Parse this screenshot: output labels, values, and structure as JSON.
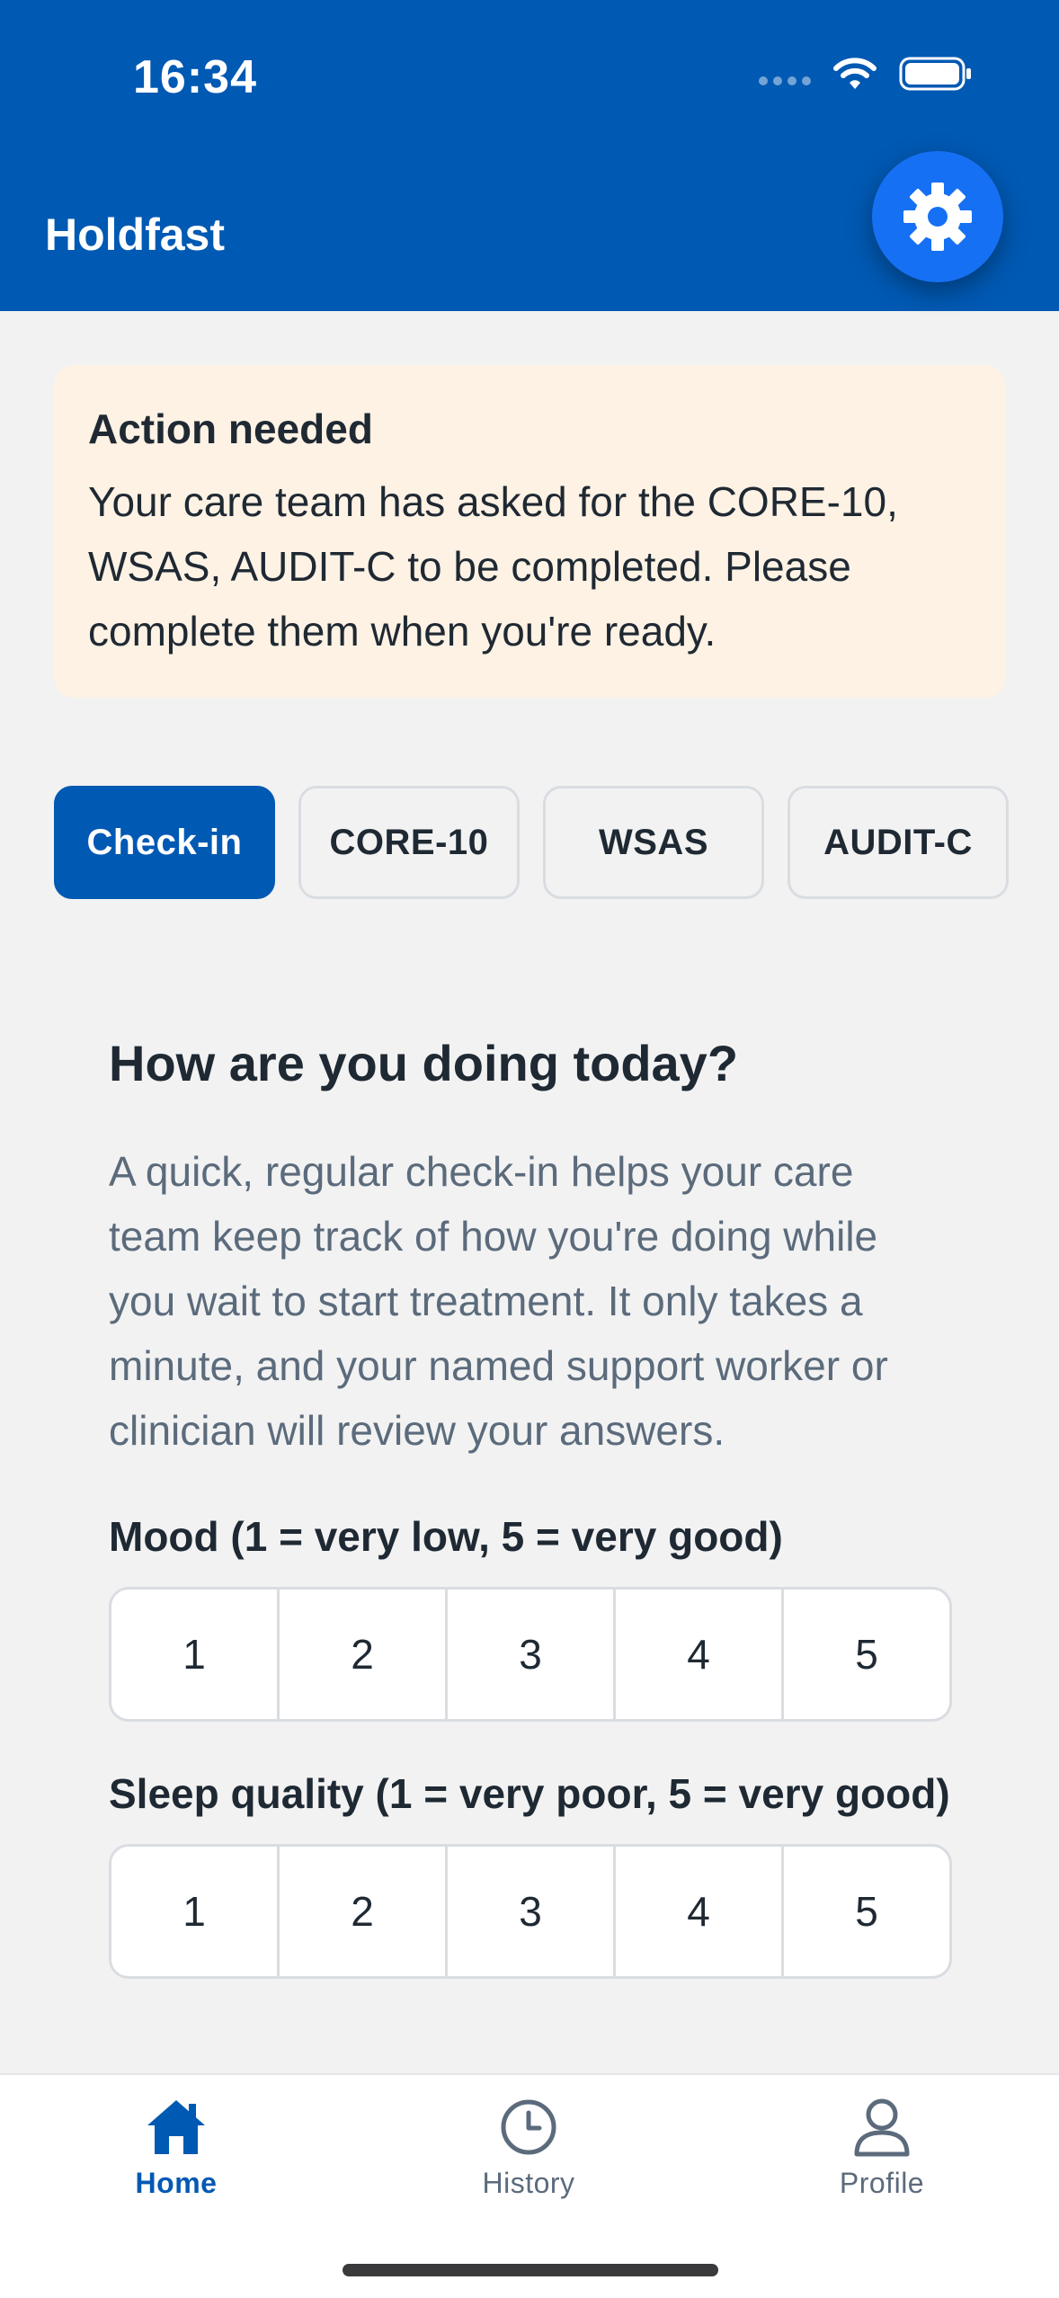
{
  "status_bar": {
    "time": "16:34",
    "icons": [
      "signal-icon",
      "wifi-icon",
      "battery-icon"
    ]
  },
  "header": {
    "title": "Holdfast",
    "settings_icon": "gear-icon"
  },
  "alert": {
    "title": "Action needed",
    "body": "Your care team has asked for the CORE-10, WSAS, AUDIT-C to be completed. Please complete them when you're ready."
  },
  "tabs": [
    {
      "label": "Check-in",
      "active": true
    },
    {
      "label": "CORE-10",
      "active": false
    },
    {
      "label": "WSAS",
      "active": false
    },
    {
      "label": "AUDIT-C",
      "active": false
    }
  ],
  "checkin": {
    "title": "How are you doing today?",
    "description": "A quick, regular check-in helps your care team keep track of how you're doing while you wait to start treatment. It only takes a minute, and your named support worker or clinician will review your answers.",
    "questions": [
      {
        "label": "Mood (1 = very low, 5 = very good)",
        "options": [
          "1",
          "2",
          "3",
          "4",
          "5"
        ]
      },
      {
        "label": "Sleep quality (1 = very poor, 5 = very good)",
        "options": [
          "1",
          "2",
          "3",
          "4",
          "5"
        ]
      }
    ]
  },
  "bottom_nav": [
    {
      "label": "Home",
      "icon": "home-icon",
      "active": true
    },
    {
      "label": "History",
      "icon": "clock-icon",
      "active": false
    },
    {
      "label": "Profile",
      "icon": "person-icon",
      "active": false
    }
  ],
  "colors": {
    "primary": "#0059b3",
    "fab": "#1670f3",
    "alert_bg": "#fef2e4",
    "background": "#f2f2f2",
    "muted_text": "#5b6b7c"
  }
}
